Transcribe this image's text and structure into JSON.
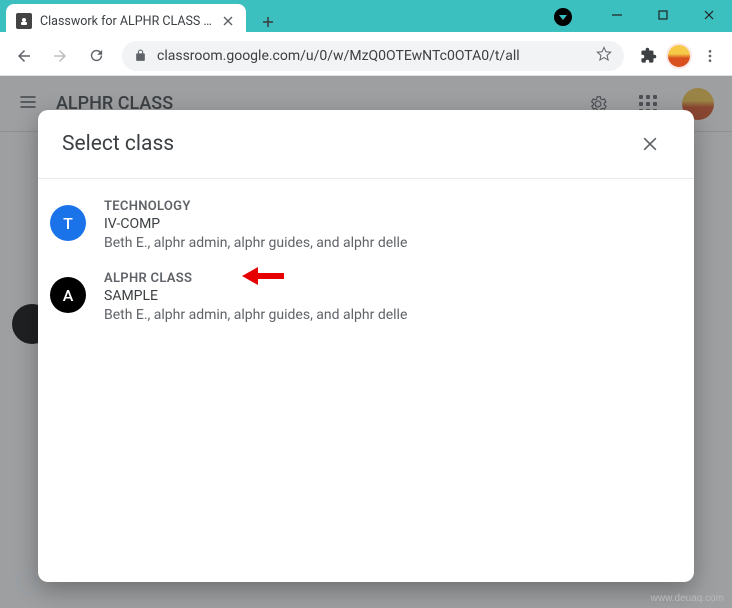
{
  "window": {
    "tab_title": "Classwork for ALPHR CLASS SAM"
  },
  "toolbar": {
    "url": "classroom.google.com/u/0/w/MzQ0OTEwNTc0OTA0/t/all"
  },
  "page": {
    "class_title": "ALPHR CLASS"
  },
  "modal": {
    "title": "Select class",
    "classes": [
      {
        "avatar_letter": "T",
        "name": "TECHNOLOGY",
        "section": "IV-COMP",
        "teachers": "Beth E., alphr admin, alphr guides, and alphr delle"
      },
      {
        "avatar_letter": "A",
        "name": "ALPHR CLASS",
        "section": "SAMPLE",
        "teachers": "Beth E., alphr admin, alphr guides, and alphr delle"
      }
    ]
  },
  "watermark": "www.deuaq.com"
}
